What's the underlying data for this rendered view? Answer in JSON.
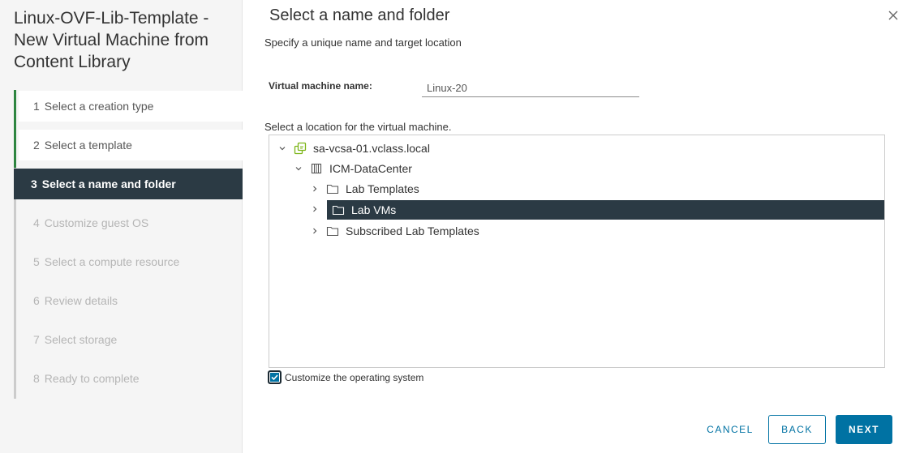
{
  "wizard": {
    "title": "Linux-OVF-Lib-Template - New Virtual Machine from Content Library",
    "steps": [
      {
        "num": "1",
        "label": "Select a creation type",
        "state": "done"
      },
      {
        "num": "2",
        "label": "Select a template",
        "state": "done"
      },
      {
        "num": "3",
        "label": "Select a name and folder",
        "state": "active"
      },
      {
        "num": "4",
        "label": "Customize guest OS",
        "state": "todo"
      },
      {
        "num": "5",
        "label": "Select a compute resource",
        "state": "todo"
      },
      {
        "num": "6",
        "label": "Review details",
        "state": "todo"
      },
      {
        "num": "7",
        "label": "Select storage",
        "state": "todo"
      },
      {
        "num": "8",
        "label": "Ready to complete",
        "state": "todo"
      }
    ]
  },
  "page": {
    "title": "Select a name and folder",
    "subtitle": "Specify a unique name and target location",
    "close_icon": "close-icon"
  },
  "form": {
    "vm_name_label": "Virtual machine name:",
    "vm_name_value": "Linux-20",
    "location_label": "Select a location for the virtual machine."
  },
  "tree": {
    "vcenter": {
      "label": "sa-vcsa-01.vclass.local",
      "icon": "vcenter-icon",
      "expanded": true
    },
    "datacenter": {
      "label": "ICM-DataCenter",
      "icon": "datacenter-icon",
      "expanded": true
    },
    "folders": [
      {
        "label": "Lab Templates",
        "icon": "folder-icon",
        "selected": false
      },
      {
        "label": "Lab VMs",
        "icon": "folder-icon",
        "selected": true
      },
      {
        "label": "Subscribed Lab Templates",
        "icon": "folder-icon",
        "selected": false
      }
    ]
  },
  "customize": {
    "label": "Customize the operating system",
    "checked": true
  },
  "buttons": {
    "cancel": "CANCEL",
    "back": "BACK",
    "next": "NEXT"
  },
  "colors": {
    "accent": "#0072a3",
    "active_step_bg": "#2b3a44",
    "progress_green": "#2e8540",
    "vcenter_icon": "#7cb518"
  }
}
